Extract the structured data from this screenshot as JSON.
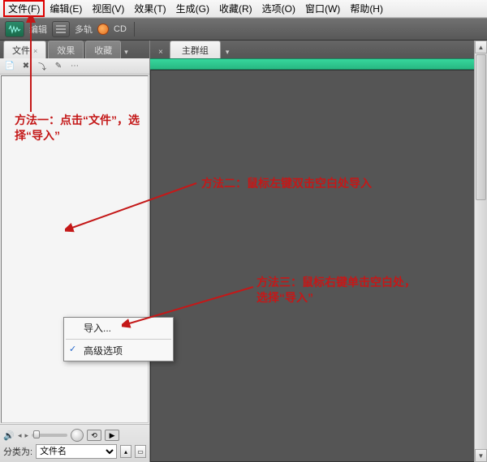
{
  "menubar": {
    "items": [
      {
        "label": "文件(F)"
      },
      {
        "label": "编辑(E)"
      },
      {
        "label": "视图(V)"
      },
      {
        "label": "效果(T)"
      },
      {
        "label": "生成(G)"
      },
      {
        "label": "收藏(R)"
      },
      {
        "label": "选项(O)"
      },
      {
        "label": "窗口(W)"
      },
      {
        "label": "帮助(H)"
      }
    ]
  },
  "toolbar": {
    "edit_label": "编辑",
    "multitrack_label": "多轨",
    "cd_label": "CD"
  },
  "left_panel": {
    "tabs": {
      "files": "文件",
      "effects": "效果",
      "favorites": "收藏"
    },
    "sort_label": "分类为:",
    "sort_value": "文件名"
  },
  "right_panel": {
    "tab_label": "主群组"
  },
  "context_menu": {
    "import": "导入...",
    "advanced": "高级选项"
  },
  "annotations": {
    "method1": "方法一：点击“文件”，选择“导入”",
    "method2": "方法二：鼠标左键双击空白处导入",
    "method3": "方法三：鼠标右键单击空白处，选择“导入”"
  }
}
